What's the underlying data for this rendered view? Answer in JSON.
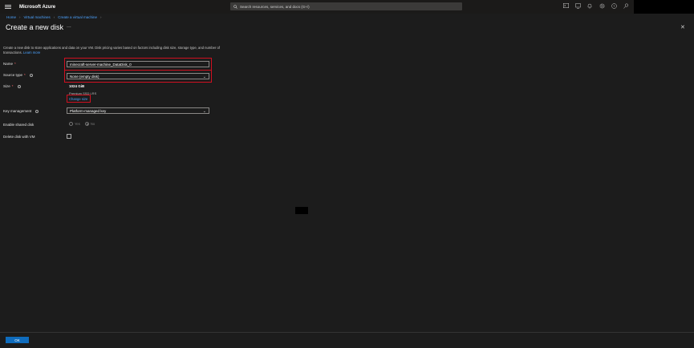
{
  "topbar": {
    "brand": "Microsoft Azure",
    "search_placeholder": "Search resources, services, and docs (G+/)",
    "icons": [
      "terminal-icon",
      "directory-filter-icon",
      "bell-icon",
      "gear-icon",
      "help-icon",
      "feedback-icon"
    ]
  },
  "breadcrumb": [
    "Home",
    "Virtual machines",
    "Create a virtual machine"
  ],
  "page": {
    "title": "Create a new disk",
    "more_label": "...",
    "close_label": "✕",
    "description": "Create a new disk to store applications and data on your VM. Disk pricing varies based on factors including disk size, storage type, and number of transactions.",
    "learn_more": "Learn more"
  },
  "form": {
    "name_label": "Name",
    "name_value": "minecraft-server-machine_DataDisk_0",
    "source_type_label": "Source type",
    "source_type_value": "None (empty disk)",
    "size_label": "Size",
    "size_value": "1024 GiB",
    "size_sub": "Premium SSD LRS",
    "change_size": "Change size",
    "key_mgmt_label": "Key management",
    "key_mgmt_value": "Platform-managed key",
    "shared_disk_label": "Enable shared disk",
    "shared_yes": "Yes",
    "shared_no": "No",
    "delete_with_vm_label": "Delete disk with VM"
  },
  "footer": {
    "ok_label": "OK"
  },
  "colors": {
    "accent": "#0f6cbd",
    "link": "#4ca3ff",
    "highlight": "#d01020"
  }
}
